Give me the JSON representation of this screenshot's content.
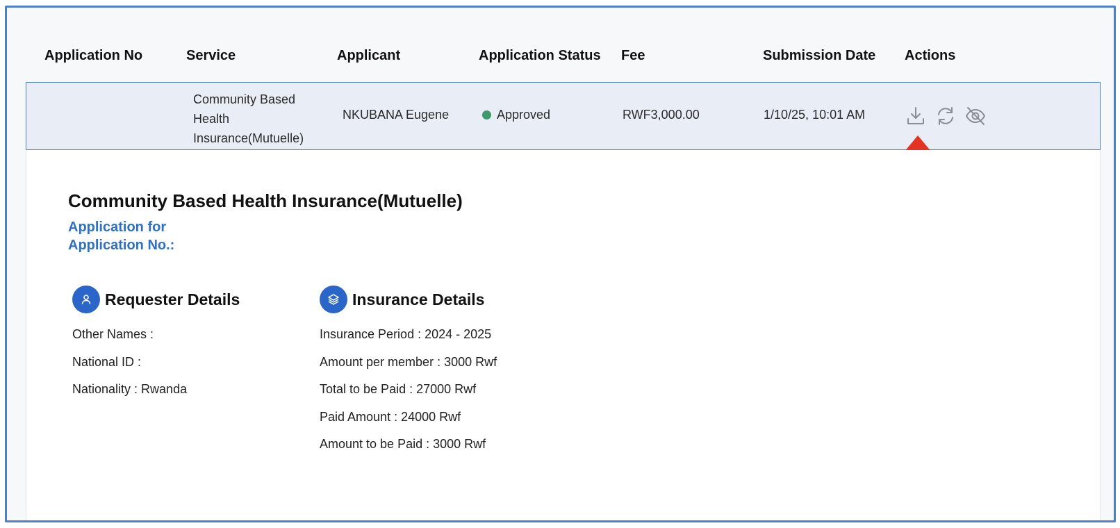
{
  "table": {
    "headers": [
      "Application No",
      "Service",
      "Applicant",
      "Application Status",
      "Fee",
      "Submission Date",
      "Actions"
    ],
    "row": {
      "application_no": "",
      "service": "Community Based Health Insurance(Mutuelle)",
      "applicant": "NKUBANA Eugene",
      "status": "Approved",
      "fee": "RWF3,000.00",
      "submission_date": "1/10/25, 10:01 AM",
      "actions": [
        "download-icon",
        "refresh-icon",
        "hide-icon"
      ]
    }
  },
  "detail": {
    "title": "Community Based Health Insurance(Mutuelle)",
    "subtitle_line1": "Application for",
    "subtitle_line2": "Application No.:",
    "requester": {
      "title": "Requester Details",
      "fields": [
        "Other Names :",
        "National ID :",
        "Nationality : Rwanda"
      ]
    },
    "insurance": {
      "title": "Insurance Details",
      "fields": [
        "Insurance Period : 2024 - 2025",
        "Amount per member : 3000 Rwf",
        "Total to be Paid : 27000 Rwf",
        "Paid Amount : 24000 Rwf",
        "Amount to be Paid : 3000 Rwf"
      ]
    }
  },
  "colors": {
    "accent": "#2a65c9",
    "frame_border": "#4a7fd4",
    "status_approved": "#3c9a6c",
    "annotation_arrow": "#e53222"
  }
}
